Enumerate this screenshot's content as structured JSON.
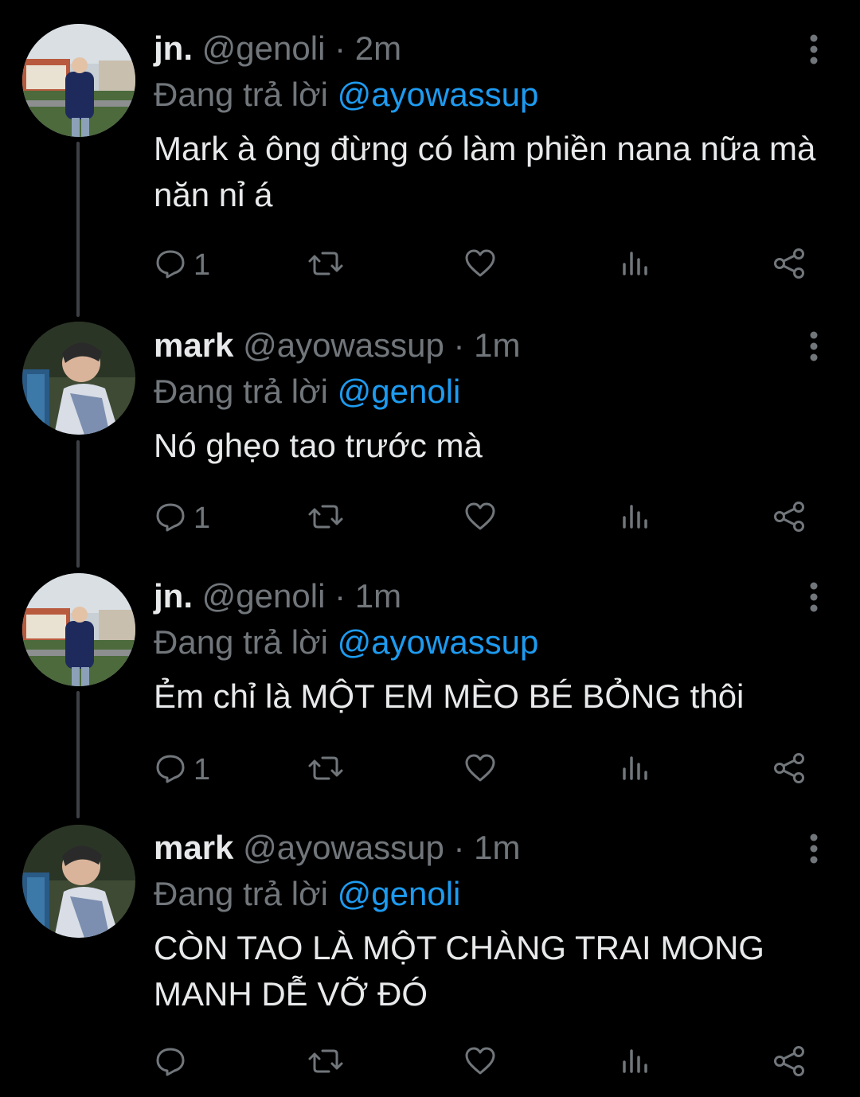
{
  "tweets": [
    {
      "name": "jn.",
      "handle": "@genoli",
      "time": "· 2m",
      "reply_prefix": "Đang trả lời",
      "reply_to": "@ayowassup",
      "text": "Mark à ông đừng có làm phiền nana nữa mà năn nỉ á",
      "reply_count": "1",
      "avatar": "jn-avatar"
    },
    {
      "name": "mark",
      "handle": "@ayowassup",
      "time": "· 1m",
      "reply_prefix": "Đang trả lời",
      "reply_to": "@genoli",
      "text": "Nó ghẹo tao trước mà",
      "reply_count": "1",
      "avatar": "mark-avatar"
    },
    {
      "name": "jn.",
      "handle": "@genoli",
      "time": "· 1m",
      "reply_prefix": "Đang trả lời",
      "reply_to": "@ayowassup",
      "text": "Ẻm chỉ là MỘT EM MÈO BÉ BỎNG thôi",
      "reply_count": "1",
      "avatar": "jn-avatar"
    },
    {
      "name": "mark",
      "handle": "@ayowassup",
      "time": "· 1m",
      "reply_prefix": "Đang trả lời",
      "reply_to": "@genoli",
      "text": "CÒN TAO LÀ MỘT CHÀNG TRAI MONG MANH DỄ VỠ ĐÓ",
      "reply_count": "",
      "avatar": "mark-avatar"
    }
  ],
  "icons": {
    "reply": "reply-icon",
    "retweet": "retweet-icon",
    "like": "like-icon",
    "views": "views-icon",
    "share": "share-icon",
    "more": "more-icon"
  },
  "colors": {
    "background": "#000000",
    "text": "#e7e9ea",
    "secondary": "#71767b",
    "link": "#1d9bf0",
    "thread_line": "#3d4145"
  }
}
